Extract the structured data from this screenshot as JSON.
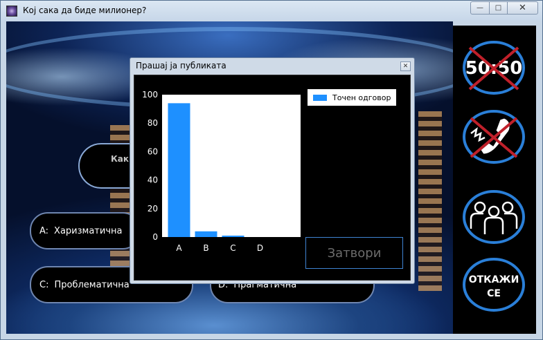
{
  "window": {
    "title": "Кој сака да биде милионер?",
    "min_glyph": "—",
    "max_glyph": "□",
    "close_glyph": "✕"
  },
  "question": {
    "text": "Каква"
  },
  "answers": [
    {
      "letter": "A:",
      "text": "Харизматична"
    },
    {
      "letter": "C:",
      "text": "Проблематична"
    },
    {
      "letter": "D:",
      "text": "Прагматична"
    }
  ],
  "lifelines": {
    "fifty_fifty": "50:50",
    "phone": "phone-a-friend-icon",
    "audience": "ask-audience-icon",
    "quit": [
      "ОТКАЖИ",
      "СЕ"
    ],
    "accent": "#2a7fd8",
    "used_mark": "#c0202a"
  },
  "dialog": {
    "title": "Прашај ја публиката",
    "close_glyph": "✕",
    "close_button": "Затвори"
  },
  "chart_data": {
    "type": "bar",
    "categories": [
      "A",
      "B",
      "C",
      "D"
    ],
    "series": [
      {
        "name": "Точен одговор",
        "values": [
          94,
          4,
          1,
          0
        ],
        "color": "#1e90ff"
      }
    ],
    "ylim": [
      0,
      100
    ],
    "yticks": [
      0,
      20,
      40,
      60,
      80,
      100
    ],
    "legend": "top-right"
  }
}
